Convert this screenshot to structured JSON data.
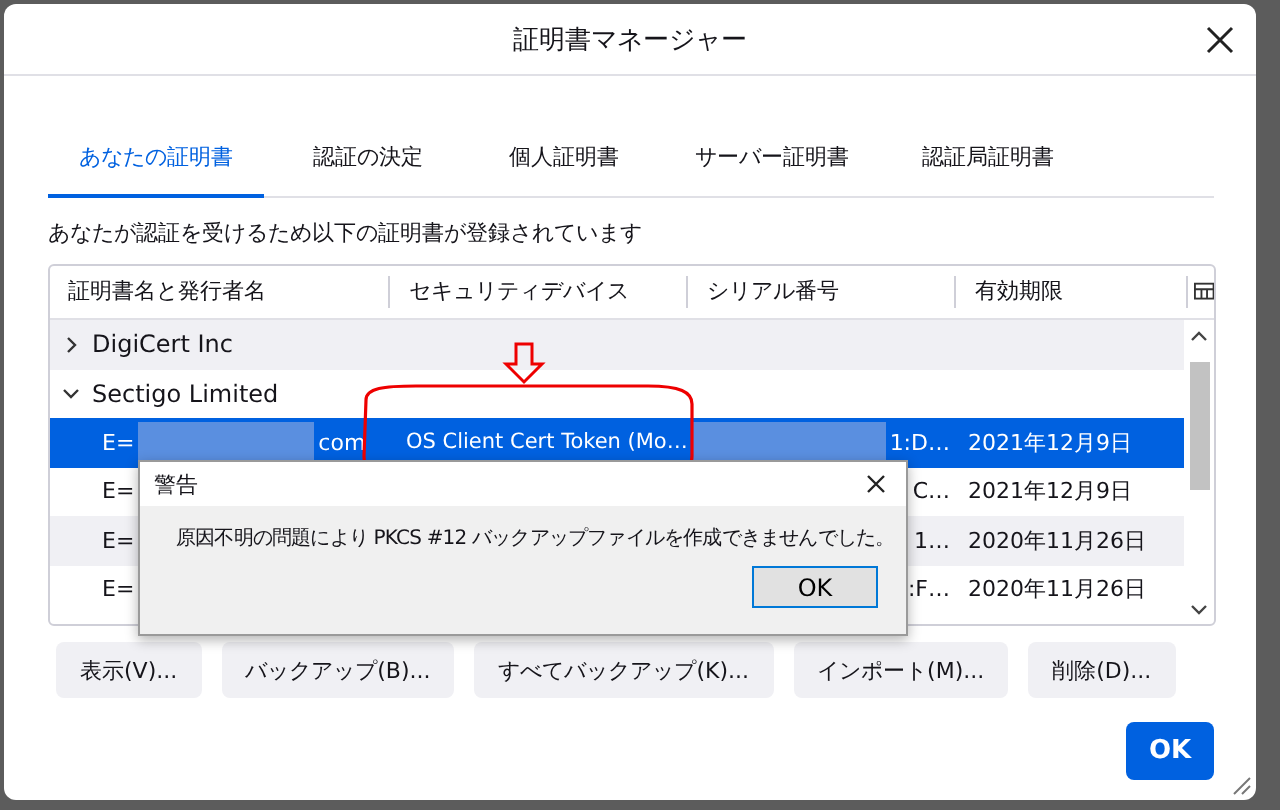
{
  "window": {
    "title": "証明書マネージャー"
  },
  "tabs": [
    {
      "label": "あなたの証明書",
      "selected": true
    },
    {
      "label": "認証の決定",
      "selected": false
    },
    {
      "label": "個人証明書",
      "selected": false
    },
    {
      "label": "サーバー証明書",
      "selected": false
    },
    {
      "label": "認証局証明書",
      "selected": false
    }
  ],
  "description": "あなたが認証を受けるため以下の証明書が登録されています",
  "table": {
    "columns": [
      "証明書名と発行者名",
      "セキュリティデバイス",
      "シリアル番号",
      "有効期限"
    ],
    "rows": [
      {
        "kind": "group",
        "label": "DigiCert Inc",
        "expanded": false
      },
      {
        "kind": "group",
        "label": "Sectigo Limited",
        "expanded": true
      },
      {
        "kind": "cert",
        "selected": true,
        "redacted": true,
        "name": "E=",
        "name_end": "com",
        "device": "OS Client Cert Token (Mo…",
        "serial": "1:D…",
        "expiry": "2021年12月9日"
      },
      {
        "kind": "cert",
        "selected": false,
        "redacted": false,
        "name": "E=",
        "serial": "C…",
        "expiry": "2021年12月9日"
      },
      {
        "kind": "cert",
        "selected": false,
        "redacted": false,
        "name": "E=",
        "serial": "1…",
        "expiry": "2020年11月26日"
      },
      {
        "kind": "cert",
        "selected": false,
        "redacted": false,
        "name": "E=",
        "serial": ":F…",
        "expiry": "2020年11月26日"
      }
    ]
  },
  "buttons": [
    "表示(V)...",
    "バックアップ(B)...",
    "すべてバックアップ(K)...",
    "インポート(M)...",
    "削除(D)..."
  ],
  "ok_button": "OK",
  "alert": {
    "title": "警告",
    "message": "原因不明の問題により PKCS #12 バックアップファイルを作成できませんでした。",
    "button": "OK"
  }
}
